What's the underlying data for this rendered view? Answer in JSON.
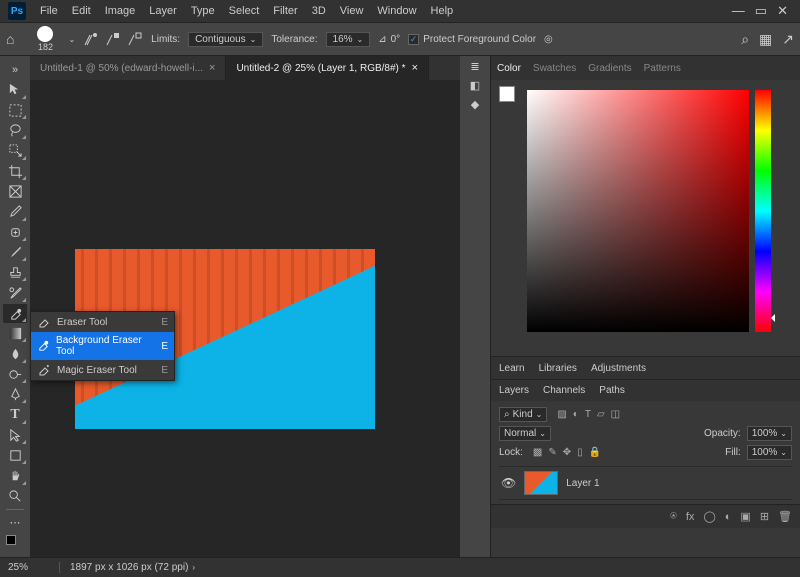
{
  "app_logo": "Ps",
  "menus": [
    "File",
    "Edit",
    "Image",
    "Layer",
    "Type",
    "Select",
    "Filter",
    "3D",
    "View",
    "Window",
    "Help"
  ],
  "window_controls": {
    "min": "—",
    "frame": "▭",
    "close": "✕"
  },
  "options_bar": {
    "brush_size": "182",
    "limits_label": "Limits:",
    "limits_value": "Contiguous",
    "tolerance_label": "Tolerance:",
    "tolerance_value": "16%",
    "angle_value": "0°",
    "protect_fg_label": "Protect Foreground Color",
    "protect_fg_checked": "✓"
  },
  "tabs": [
    {
      "label": "Untitled-1 @ 50% (edward-howell-i...",
      "active": false
    },
    {
      "label": "Untitled-2 @ 25% (Layer 1, RGB/8#) *",
      "active": true
    }
  ],
  "flyout": {
    "items": [
      {
        "label": "Eraser Tool",
        "key": "E",
        "selected": false
      },
      {
        "label": "Background Eraser Tool",
        "key": "E",
        "selected": true
      },
      {
        "label": "Magic Eraser Tool",
        "key": "E",
        "selected": false
      }
    ]
  },
  "panels": {
    "color_tabs": [
      "Color",
      "Swatches",
      "Gradients",
      "Patterns"
    ],
    "learn_tabs": [
      "Learn",
      "Libraries",
      "Adjustments"
    ],
    "layers_tabs": [
      "Layers",
      "Channels",
      "Paths"
    ],
    "layers": {
      "kind_label": "Kind",
      "blend_mode": "Normal",
      "opacity_label": "Opacity:",
      "opacity_value": "100%",
      "lock_label": "Lock:",
      "fill_label": "Fill:",
      "fill_value": "100%",
      "layer_name": "Layer 1"
    }
  },
  "status": {
    "zoom": "25%",
    "doc_info": "1897 px x 1026 px (72 ppi)"
  },
  "icons": {
    "search": "⌕",
    "grid": "▦",
    "share": "↗",
    "home": "⌂",
    "chev_down": "⌄",
    "angle_sym": "⊿",
    "ring": "◎",
    "eye": "👁"
  }
}
